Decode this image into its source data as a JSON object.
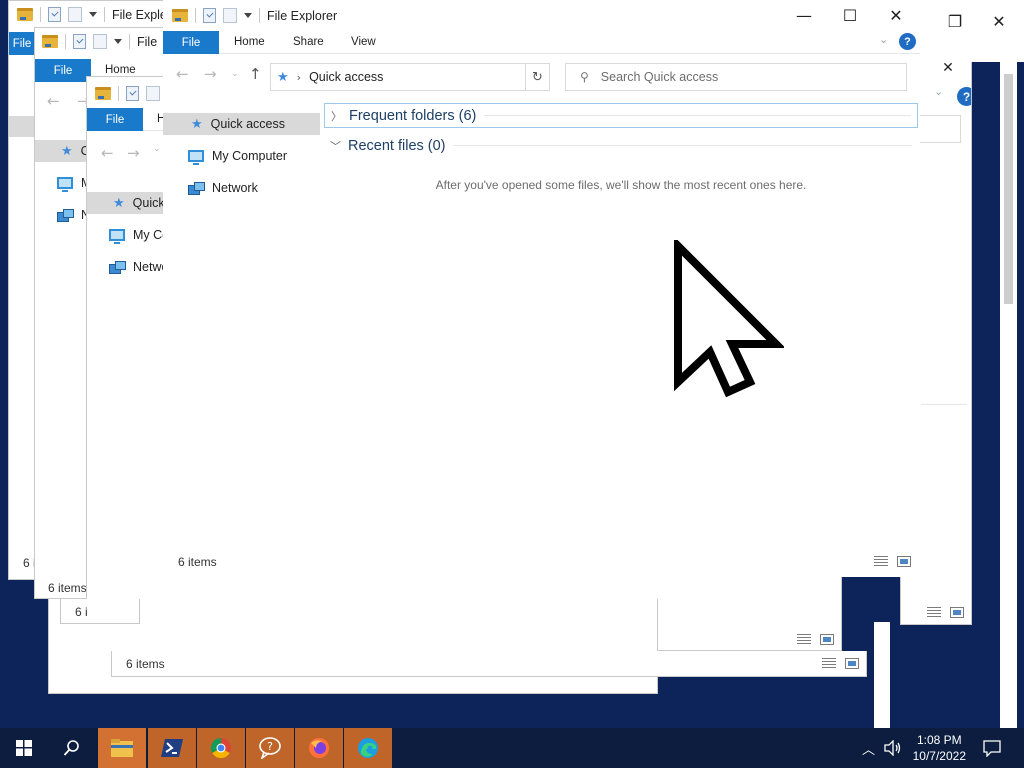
{
  "explorer": {
    "title": "File Explorer",
    "title_partial": "File Exple",
    "title_partial_2": "File",
    "tabs": {
      "file": "File",
      "home": "Home",
      "share": "Share",
      "view": "View",
      "home_partial": "H"
    },
    "address": {
      "location": "Quick access"
    },
    "search": {
      "placeholder": "Search Quick access"
    },
    "sidebar": {
      "quick_access": "Quick access",
      "my_computer": "My Computer",
      "network": "Network",
      "quick_partial": "Quick",
      "my_partial": "My Co",
      "net_partial": "Netwo",
      "q1": "C",
      "m1": "M",
      "n1": "N"
    },
    "sections": {
      "frequent": "Frequent folders (6)",
      "recent": "Recent files (0)",
      "recent_empty_message": "After you've opened some files, we'll show the most recent ones here."
    },
    "status": {
      "items": "6 items",
      "items_partial": "6 i"
    }
  },
  "taskbar": {
    "time": "1:08 PM",
    "date": "10/7/2022",
    "apps": [
      "file-explorer",
      "powershell",
      "chrome",
      "help",
      "firefox",
      "edge"
    ]
  },
  "colors": {
    "accent": "#1979ca",
    "desktop": "#0c2459",
    "taskbar": "#0c1d3f",
    "pinned_app_bg": "#c0652a",
    "selected_nav_bg": "#d9d9d9"
  }
}
